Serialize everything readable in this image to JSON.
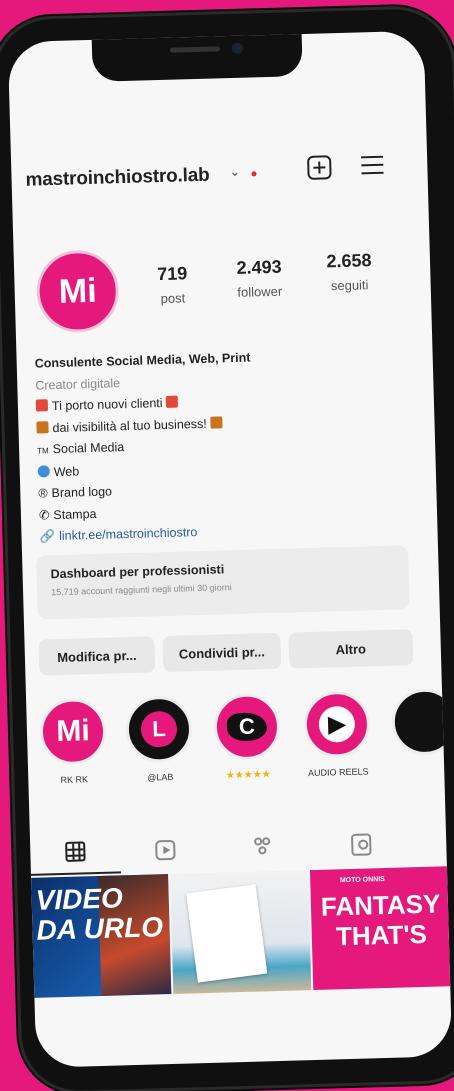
{
  "profile": {
    "username": "mastroinchiostro.lab",
    "avatar_text": "Mi"
  },
  "stats": [
    {
      "value": "719",
      "label": "post"
    },
    {
      "value": "2.493",
      "label": "follower"
    },
    {
      "value": "2.658",
      "label": "seguiti"
    }
  ],
  "bio": {
    "name": "Consulente Social Media, Web, Print",
    "category": "Creator digitale",
    "lines": [
      "Ti porto nuovi clienti",
      "dai visibilità al tuo business!",
      "Social Media",
      "Web",
      "Brand logo",
      "Stampa"
    ],
    "link": "linktr.ee/mastroinchiostro"
  },
  "dashboard": {
    "title": "Dashboard per professionisti",
    "subtitle": "15.719 account raggiunti negli ultimi 30 giorni"
  },
  "buttons": {
    "edit": "Modifica pr...",
    "share": "Condividi pr...",
    "more": "Altro"
  },
  "highlights": [
    {
      "text": "Mi",
      "label": "RK RK"
    },
    {
      "text": "L",
      "label": "@LAB"
    },
    {
      "text": "C",
      "label": "★★★★★"
    },
    {
      "text": "",
      "label": "AUDIO REELS"
    }
  ],
  "posts": {
    "post1_text": "VIDEO DA URLO",
    "post3_small": "MOTO ONNIS",
    "post3_text": "FANTASY THAT'S"
  },
  "colors": {
    "accent": "#e5187c",
    "link": "#2b5a9b"
  }
}
